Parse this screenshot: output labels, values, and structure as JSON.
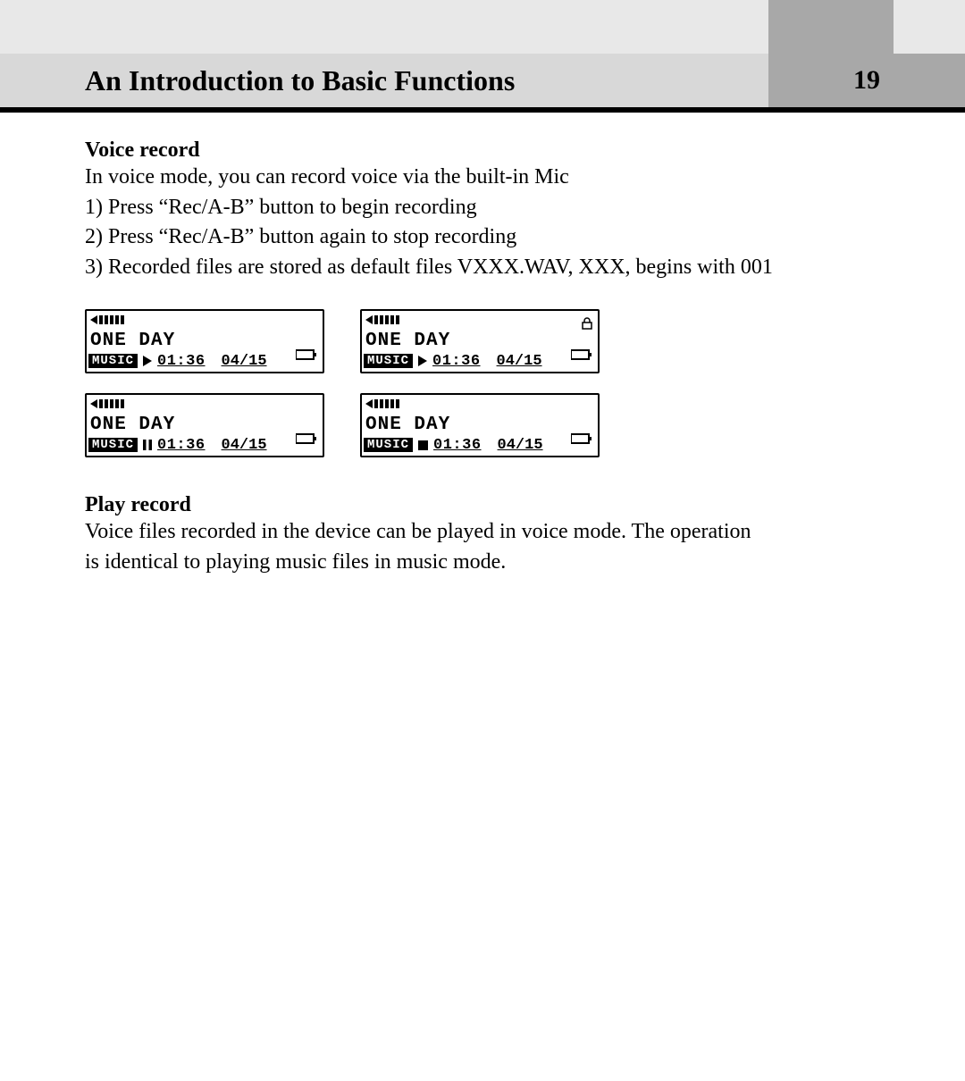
{
  "header": {
    "title": "An Introduction to Basic Functions",
    "page_number": "19"
  },
  "sections": {
    "voice_record": {
      "heading": "Voice record",
      "intro": "In voice mode, you can record voice via the built-in Mic",
      "steps": [
        "1) Press “Rec/A-B” button to begin recording",
        "2) Press “Rec/A-B” button again to stop recording",
        "3) Recorded files are stored as default files VXXX.WAV, XXX, begins with 001"
      ]
    },
    "play_record": {
      "heading": "Play record",
      "body": "Voice files recorded in the device can be played in voice mode. The operation is identical to playing music files in music mode."
    }
  },
  "screens": [
    {
      "title": "ONE DAY",
      "mode": "MUSIC",
      "state": "play",
      "time": "01:36",
      "track": "04/15",
      "lock": false
    },
    {
      "title": "ONE DAY",
      "mode": "MUSIC",
      "state": "play",
      "time": "01:36",
      "track": "04/15",
      "lock": true
    },
    {
      "title": "ONE DAY",
      "mode": "MUSIC",
      "state": "pause",
      "time": "01:36",
      "track": "04/15",
      "lock": false
    },
    {
      "title": "ONE DAY",
      "mode": "MUSIC",
      "state": "stop",
      "time": "01:36",
      "track": "04/15",
      "lock": false
    }
  ]
}
